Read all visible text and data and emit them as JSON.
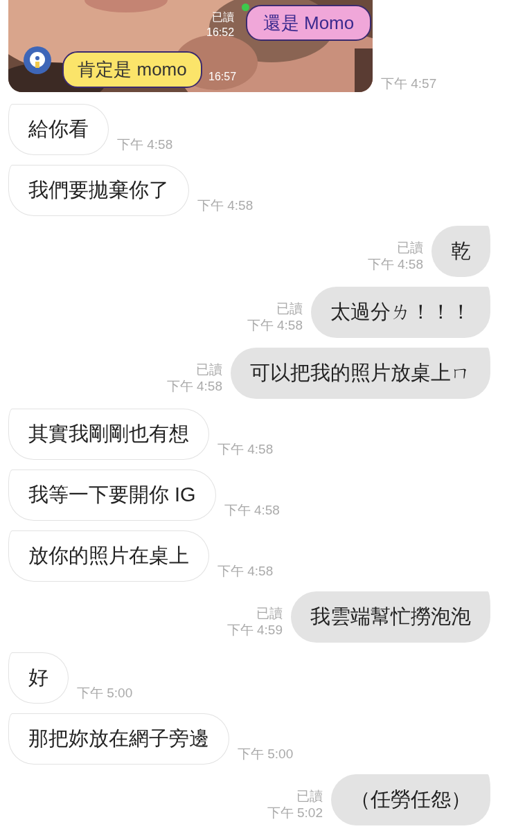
{
  "image_message": {
    "overlay": {
      "outgoing": {
        "read": "已讀",
        "time": "16:52",
        "text": "還是 Momo"
      },
      "incoming": {
        "text": "肯定是 momo",
        "time": "16:57"
      }
    },
    "time": "下午 4:57"
  },
  "messages": [
    {
      "kind": "in",
      "text": "給你看",
      "time": "下午 4:58"
    },
    {
      "kind": "in",
      "text": "我們要拋棄你了",
      "time": "下午 4:58"
    },
    {
      "kind": "out",
      "read": "已讀",
      "text": "乾",
      "time": "下午 4:58"
    },
    {
      "kind": "out",
      "read": "已讀",
      "text": "太過分ㄌ！！！",
      "time": "下午 4:58"
    },
    {
      "kind": "out",
      "read": "已讀",
      "text": "可以把我的照片放桌上ㄇ",
      "time": "下午 4:58"
    },
    {
      "kind": "in",
      "text": "其實我剛剛也有想",
      "time": "下午 4:58"
    },
    {
      "kind": "in",
      "text": "我等一下要開你 IG",
      "time": "下午 4:58"
    },
    {
      "kind": "in",
      "text": "放你的照片在桌上",
      "time": "下午 4:58"
    },
    {
      "kind": "out",
      "read": "已讀",
      "text": "我雲端幫忙撈泡泡",
      "time": "下午 4:59"
    },
    {
      "kind": "in",
      "text": "好",
      "time": "下午 5:00"
    },
    {
      "kind": "in",
      "text": "那把妳放在網子旁邊",
      "time": "下午 5:00"
    },
    {
      "kind": "out",
      "read": "已讀",
      "text": "（任勞任怨）",
      "time": "下午 5:02"
    }
  ]
}
